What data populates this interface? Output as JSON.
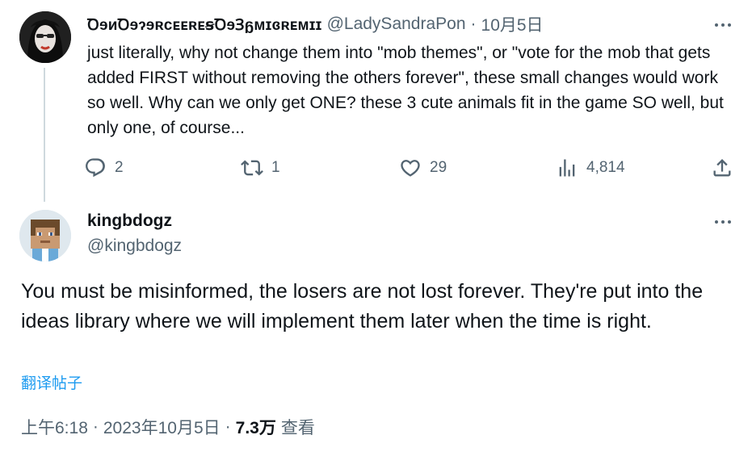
{
  "parent_tweet": {
    "display_name": "ꝹɘᴎꝹɘɂɘʀᴄᴇᴇʀᴇꞩꝹɘꞫᵷᴍɪɞʀᴇᴍɪɪ",
    "handle": "@LadySandraPon",
    "separator": "·",
    "date": "10月5日",
    "text": "just literally, why not change them into \"mob themes\", or \"vote for the mob that gets added FIRST without removing the others forever\", these small changes would work so well. Why can we only get ONE? these 3 cute animals fit in the game SO well, but only one, of course...",
    "replies": "2",
    "reposts": "1",
    "likes": "29",
    "views": "4,814"
  },
  "reply_tweet": {
    "display_name": "kingbdogz",
    "handle": "@kingbdogz",
    "text": "You must be misinformed, the losers are not lost forever. They're put into the ideas library where we will implement them later when the time is right.",
    "translate_label": "翻译帖子",
    "time": "上午6:18",
    "sep1": "·",
    "date": "2023年10月5日",
    "sep2": "·",
    "views_count": "7.3万",
    "views_label": "查看"
  },
  "icons": {
    "reply": "reply-icon",
    "repost": "repost-icon",
    "like": "heart-icon",
    "views": "views-icon",
    "share": "share-icon",
    "more": "more-icon"
  },
  "colors": {
    "text": "#0f1419",
    "secondary": "#536471",
    "link": "#1d9bf0",
    "thread_line": "#cfd9de"
  }
}
